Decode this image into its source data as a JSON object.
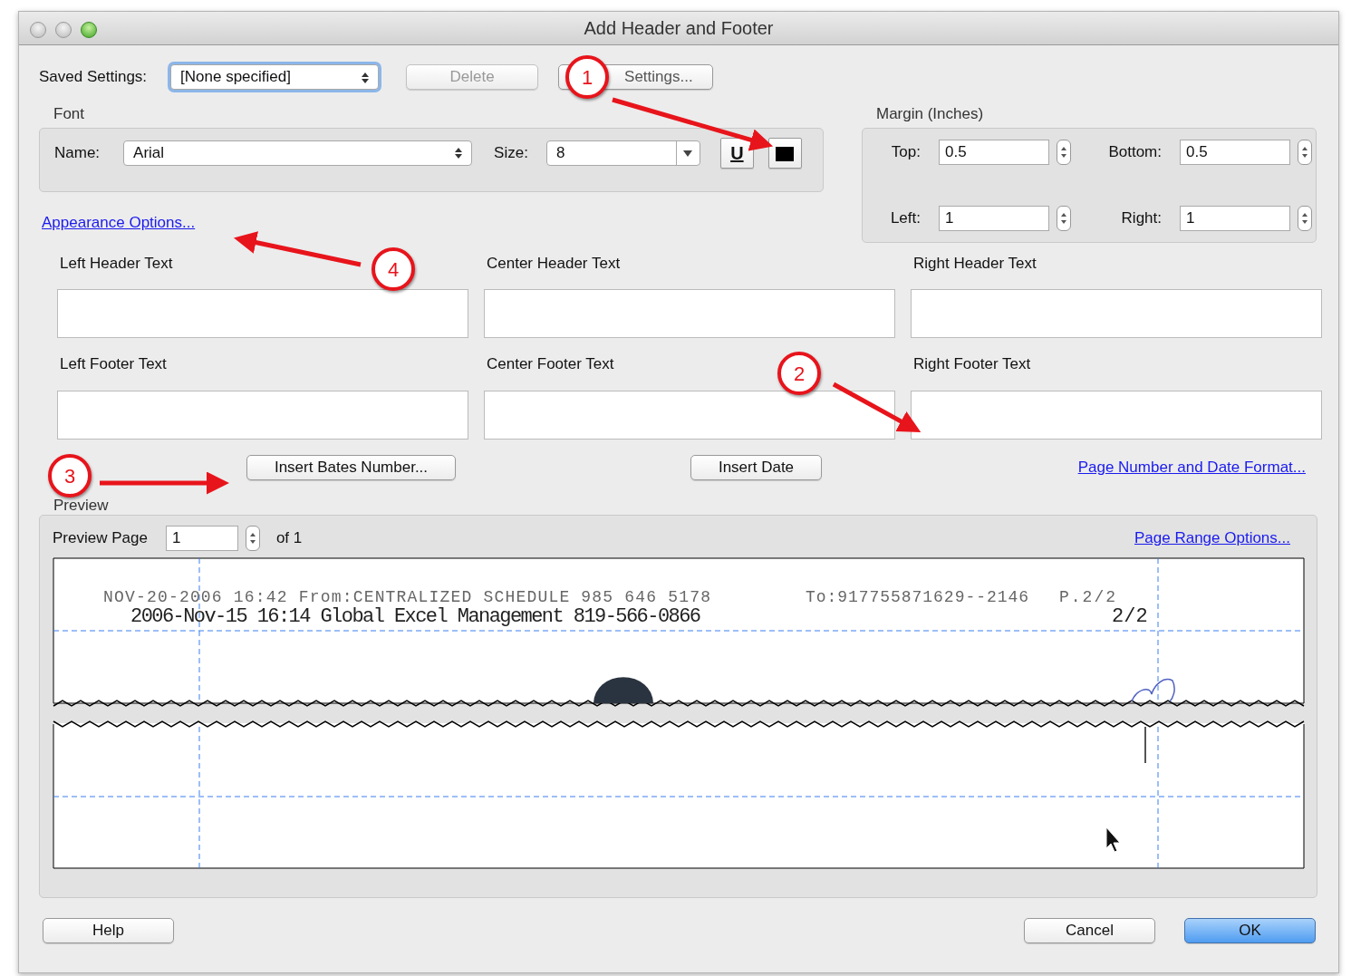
{
  "window": {
    "title": "Add Header and Footer"
  },
  "saved_settings": {
    "label": "Saved Settings:",
    "value": "[None specified]",
    "buttons": [
      {
        "label": "Delete",
        "disabled": true
      },
      {
        "label": "Settings...",
        "disabled": false
      }
    ]
  },
  "font": {
    "title": "Font",
    "name_label": "Name:",
    "name": "Arial",
    "size_label": "Size:",
    "size": "8",
    "underline_label": "U"
  },
  "margin": {
    "title": "Margin (Inches)",
    "fields": [
      {
        "label": "Top:",
        "value": "0.5"
      },
      {
        "label": "Bottom:",
        "value": "0.5"
      },
      {
        "label": "Left:",
        "value": "1"
      },
      {
        "label": "Right:",
        "value": "1"
      }
    ]
  },
  "appearance_link": "Appearance Options...",
  "header_fields": [
    {
      "label": "Left Header Text"
    },
    {
      "label": "Center Header Text"
    },
    {
      "label": "Right Header Text"
    }
  ],
  "footer_fields": [
    {
      "label": "Left Footer Text"
    },
    {
      "label": "Center Footer Text"
    },
    {
      "label": "Right Footer Text"
    }
  ],
  "actions": [
    {
      "label": "Insert Bates Number...",
      "kind": "button"
    },
    {
      "label": "Insert Date",
      "kind": "button"
    },
    {
      "label": "Page Number and Date Format...",
      "kind": "link"
    }
  ],
  "preview": {
    "title": "Preview",
    "page_label": "Preview Page",
    "page": "1",
    "of_label": "of 1",
    "range_link": "Page Range Options...",
    "document_lines": [
      {
        "text": "NOV-20-2006 16:42 From:CENTRALIZED SCHEDULE 985 646 5178",
        "kind": "faint"
      },
      {
        "text": "To:917755871629--2146",
        "kind": "faint"
      },
      {
        "text": "P.2/2",
        "kind": "faint"
      },
      {
        "text": "2006-Nov-15 16:14 Global Excel Management 819-566-0866",
        "kind": "bold"
      },
      {
        "text": "2/2",
        "kind": "bold"
      }
    ]
  },
  "callouts": [
    {
      "number": "1"
    },
    {
      "number": "2"
    },
    {
      "number": "3"
    },
    {
      "number": "4"
    }
  ],
  "buttons": [
    {
      "label": "Help",
      "default": false
    },
    {
      "label": "Cancel",
      "default": false
    },
    {
      "label": "OK",
      "default": true
    }
  ]
}
